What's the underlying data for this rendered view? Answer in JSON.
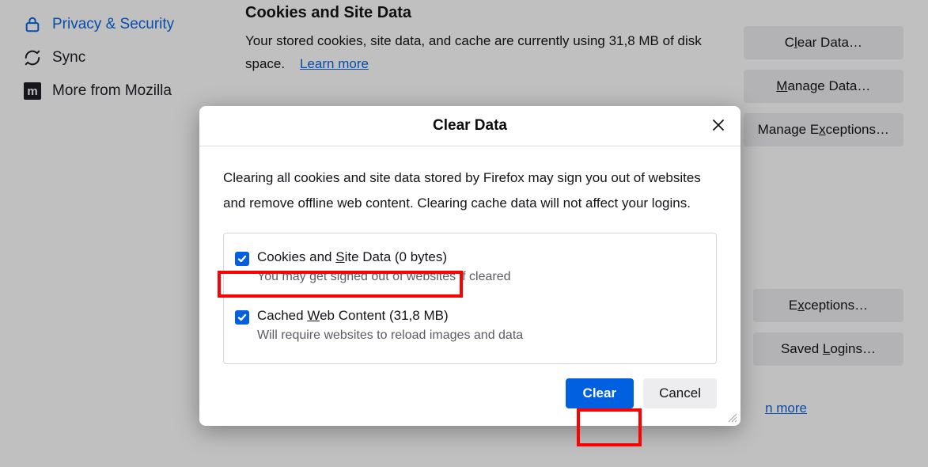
{
  "sidebar": {
    "privacy": "Privacy & Security",
    "sync": "Sync",
    "more": "More from Mozilla"
  },
  "section": {
    "title": "Cookies and Site Data",
    "desc1": "Your stored cookies, site data, and cache are currently using 31,8 MB of disk space.",
    "learn": "Learn more"
  },
  "buttons": {
    "clear_data": "Clear Data…",
    "manage_data": "Manage Data…",
    "manage_exceptions": "Manage Exceptions…",
    "exceptions": "Exceptions…",
    "saved_logins": "Saved Logins…"
  },
  "learn_bottom": "n more",
  "dialog": {
    "title": "Clear Data",
    "body": "Clearing all cookies and site data stored by Firefox may sign you out of websites and remove offline web content. Clearing cache data will not affect your logins.",
    "opt1_label_pre": "Cookies and ",
    "opt1_label_u": "S",
    "opt1_label_post": "ite Data (0 bytes)",
    "opt1_sub": "You may get signed out of websites if cleared",
    "opt2_label_pre": "Cached ",
    "opt2_label_u": "W",
    "opt2_label_post": "eb Content (31,8 MB)",
    "opt2_sub": "Will require websites to reload images and data",
    "clear": "Clear",
    "cancel": "Cancel"
  },
  "accesskeys": {
    "clear_data_u": "l",
    "manage_data_u": "M",
    "manage_exceptions_u": "x",
    "exceptions_u": "x",
    "saved_logins_u": "L"
  }
}
